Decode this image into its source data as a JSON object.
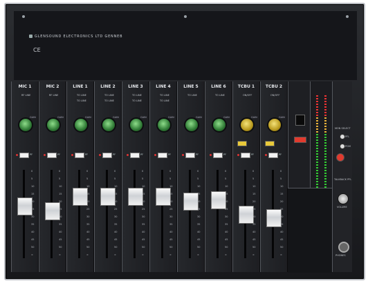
{
  "header": {
    "brand": "GLENSOUND ELECTRONICS LTD GENNEB",
    "ce_mark": "CE"
  },
  "channels": [
    {
      "label": "MIC 1",
      "sel_a": "RF LINE",
      "sel_b": "",
      "gain": "GAIN",
      "pfl": "PF",
      "knob": "green"
    },
    {
      "label": "MIC 2",
      "sel_a": "RF LINE",
      "sel_b": "",
      "gain": "GAIN",
      "pfl": "PF",
      "knob": "green"
    },
    {
      "label": "LINE 1",
      "sel_a": "TO LINE",
      "sel_b": "TO LINE",
      "gain": "GAIN",
      "pfl": "PF",
      "knob": "green"
    },
    {
      "label": "LINE 2",
      "sel_a": "TO LINE",
      "sel_b": "TO LINE",
      "gain": "GAIN",
      "pfl": "PF",
      "knob": "green"
    },
    {
      "label": "LINE 3",
      "sel_a": "TO LINE",
      "sel_b": "TO LINE",
      "gain": "GAIN",
      "pfl": "PF",
      "knob": "green"
    },
    {
      "label": "LINE 4",
      "sel_a": "TO LINE",
      "sel_b": "TO LINE",
      "gain": "GAIN",
      "pfl": "PF",
      "knob": "green"
    },
    {
      "label": "LINE 5",
      "sel_a": "TO LINE",
      "sel_b": "",
      "gain": "GAIN",
      "pfl": "PF",
      "knob": "green"
    },
    {
      "label": "LINE 6",
      "sel_a": "TO LINE",
      "sel_b": "",
      "gain": "GAIN",
      "pfl": "PF",
      "knob": "green"
    },
    {
      "label": "TCBU 1",
      "sel_a": "ON/OFF",
      "sel_b": "",
      "gain": "GAIN",
      "pfl": "PF",
      "knob": "yellow"
    },
    {
      "label": "TCBU 2",
      "sel_a": "ON/OFF",
      "sel_b": "",
      "gain": "GAIN",
      "pfl": "PF",
      "knob": "yellow"
    }
  ],
  "fader_scale": [
    "0",
    "5",
    "10",
    "15",
    "20",
    "25",
    "30",
    "35",
    "40",
    "45",
    "50",
    "∞"
  ],
  "fader_levels": [
    0.62,
    0.55,
    0.75,
    0.75,
    0.75,
    0.75,
    0.68,
    0.7,
    0.5,
    0.45
  ],
  "right_panel": {
    "mon_select": "MON SELECT",
    "opt_a": "PFL",
    "opt_b": "PGM",
    "talk_label": "TALKBACK PFL",
    "vol": "VOLUME",
    "phones": "PHONES"
  },
  "colors": {
    "accent_green": "#3b8f3f",
    "accent_yellow": "#e9c93a",
    "meter_red": "#e33",
    "meter_green": "#3c3"
  }
}
